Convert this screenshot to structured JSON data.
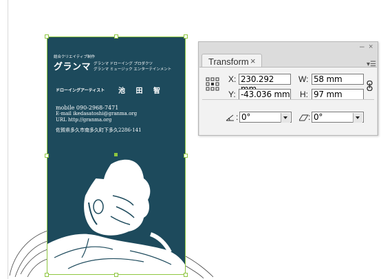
{
  "card": {
    "small_heading": "総合クリエイティブ制作",
    "brand": "グランマ",
    "brand_sub1": "グランマ ドローイング プロダクツ",
    "brand_sub2": "グランマ ミュージック エンターテインメント",
    "role": "ドローイングアーティスト",
    "name": "池 田 智",
    "mobile": "mobile   090-2968-7471",
    "email": "E-mail   ikedasatoshi@granma.org",
    "url": "URL       http://granma.org",
    "address": "佐賀県多久市南多久町下多久2286-141",
    "background_color": "#1d4a5c"
  },
  "selection": {
    "accent_color": "#8ec63f"
  },
  "transform_panel": {
    "tab_label": "Transform",
    "tab_close": "×",
    "window_minimize": "–",
    "window_close": "×",
    "menu_icon": "▾☰",
    "x_label": "X:",
    "x_value": "230.292 mm",
    "y_label": "Y:",
    "y_value": "-43.036 mm",
    "w_label": "W:",
    "w_value": "58 mm",
    "h_label": "H:",
    "h_value": "97 mm",
    "rotate_label": ":",
    "rotate_value": "0°",
    "shear_label": ":",
    "shear_value": "0°",
    "icons": [
      "reference-point-icon",
      "link-proportions-icon",
      "rotate-angle-icon",
      "shear-angle-icon",
      "chevron-down-icon"
    ]
  }
}
